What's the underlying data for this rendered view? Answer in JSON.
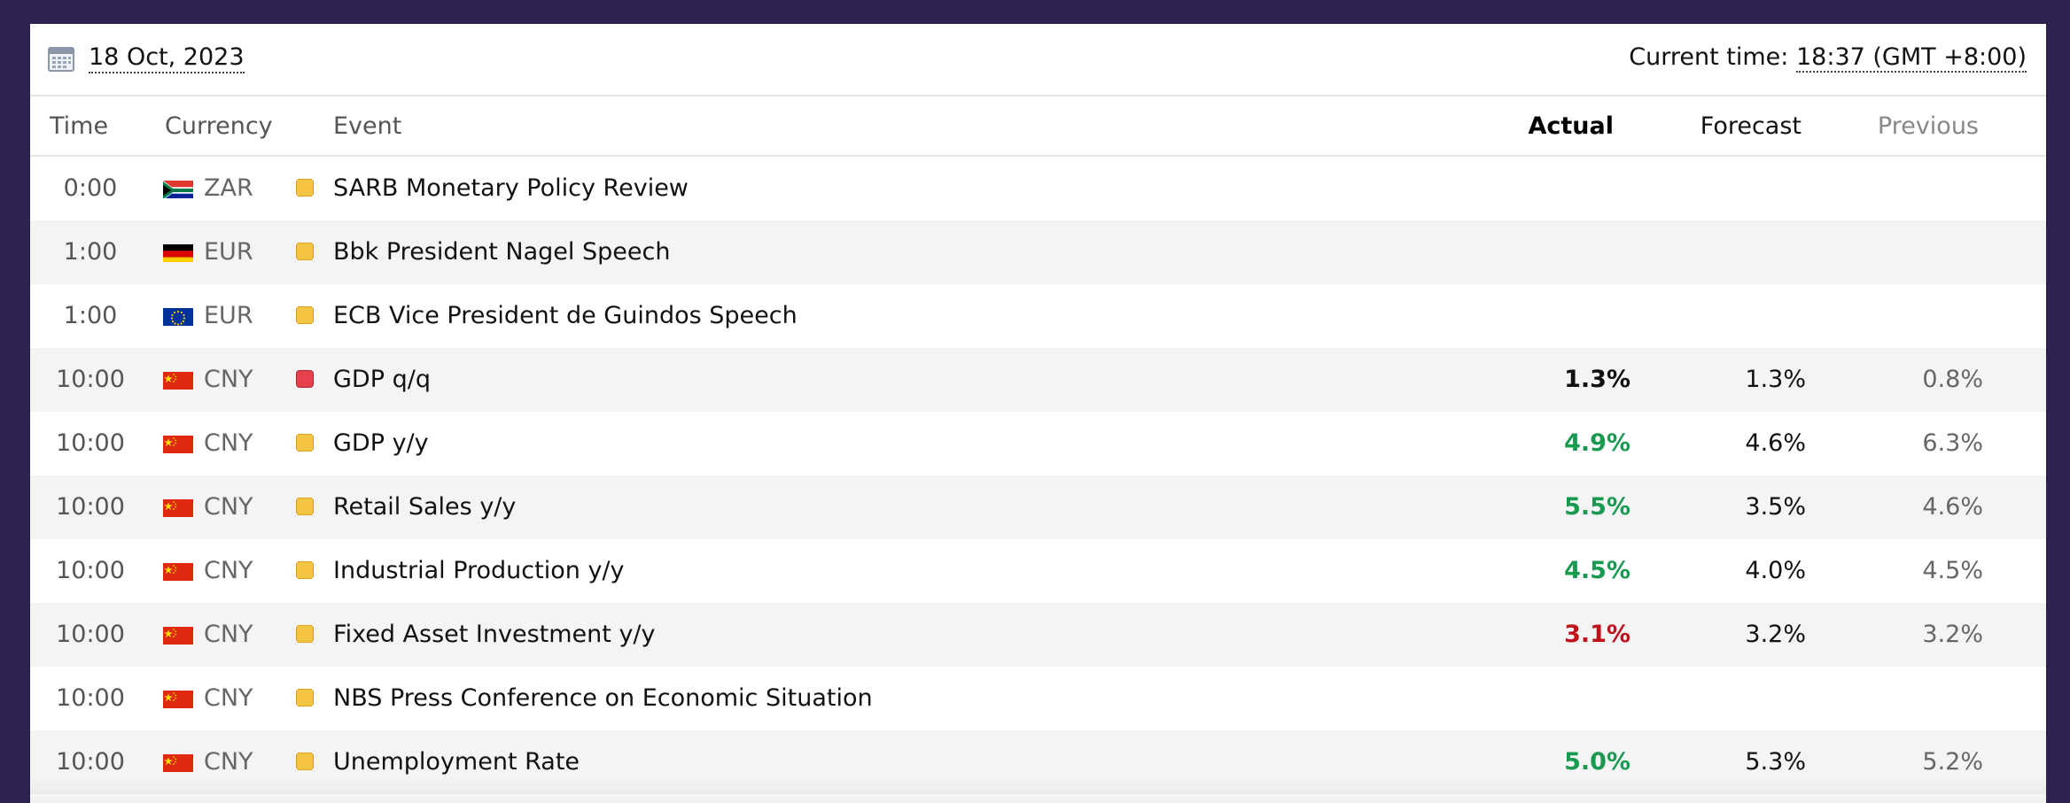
{
  "header": {
    "date": "18 Oct, 2023",
    "current_time_label": "Current time:",
    "current_time_value": "18:37 (GMT +8:00)"
  },
  "columns": {
    "time": "Time",
    "currency": "Currency",
    "event": "Event",
    "actual": "Actual",
    "forecast": "Forecast",
    "previous": "Previous"
  },
  "colors": {
    "better": "#1a9a50",
    "worse": "#c0121c",
    "neutral": "#111111",
    "impact_medium": "#f5c342",
    "impact_high": "#e6414d"
  },
  "rows": [
    {
      "time": "0:00",
      "flag": "south-africa-flag",
      "currency": "ZAR",
      "impact": "medium",
      "event": "SARB Monetary Policy Review",
      "actual": "",
      "actual_status": "neutral",
      "forecast": "",
      "previous": ""
    },
    {
      "time": "1:00",
      "flag": "germany-flag",
      "currency": "EUR",
      "impact": "medium",
      "event": "Bbk President Nagel Speech",
      "actual": "",
      "actual_status": "neutral",
      "forecast": "",
      "previous": ""
    },
    {
      "time": "1:00",
      "flag": "eu-flag",
      "currency": "EUR",
      "impact": "medium",
      "event": "ECB Vice President de Guindos Speech",
      "actual": "",
      "actual_status": "neutral",
      "forecast": "",
      "previous": ""
    },
    {
      "time": "10:00",
      "flag": "china-flag",
      "currency": "CNY",
      "impact": "high",
      "event": "GDP q/q",
      "actual": "1.3%",
      "actual_status": "neutral",
      "forecast": "1.3%",
      "previous": "0.8%"
    },
    {
      "time": "10:00",
      "flag": "china-flag",
      "currency": "CNY",
      "impact": "medium",
      "event": "GDP y/y",
      "actual": "4.9%",
      "actual_status": "better",
      "forecast": "4.6%",
      "previous": "6.3%"
    },
    {
      "time": "10:00",
      "flag": "china-flag",
      "currency": "CNY",
      "impact": "medium",
      "event": "Retail Sales y/y",
      "actual": "5.5%",
      "actual_status": "better",
      "forecast": "3.5%",
      "previous": "4.6%"
    },
    {
      "time": "10:00",
      "flag": "china-flag",
      "currency": "CNY",
      "impact": "medium",
      "event": "Industrial Production y/y",
      "actual": "4.5%",
      "actual_status": "better",
      "forecast": "4.0%",
      "previous": "4.5%"
    },
    {
      "time": "10:00",
      "flag": "china-flag",
      "currency": "CNY",
      "impact": "medium",
      "event": "Fixed Asset Investment y/y",
      "actual": "3.1%",
      "actual_status": "worse",
      "forecast": "3.2%",
      "previous": "3.2%"
    },
    {
      "time": "10:00",
      "flag": "china-flag",
      "currency": "CNY",
      "impact": "medium",
      "event": "NBS Press Conference on Economic Situation",
      "actual": "",
      "actual_status": "neutral",
      "forecast": "",
      "previous": ""
    },
    {
      "time": "10:00",
      "flag": "china-flag",
      "currency": "CNY",
      "impact": "medium",
      "event": "Unemployment Rate",
      "actual": "5.0%",
      "actual_status": "better",
      "forecast": "5.3%",
      "previous": "5.2%"
    }
  ]
}
